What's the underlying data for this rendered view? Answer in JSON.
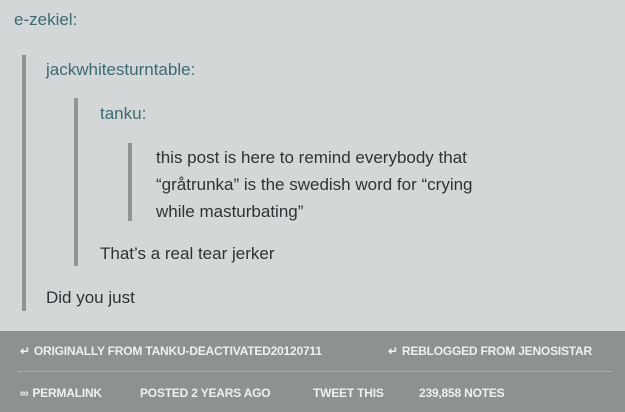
{
  "thread": {
    "level0": {
      "user": "e-zekiel",
      "colon": ":"
    },
    "level1": {
      "user": "jackwhitesturntable",
      "colon": ":",
      "reply": "Did you just"
    },
    "level2": {
      "user": "tanku",
      "colon": ":",
      "reply": "That’s a real tear jerker"
    },
    "level3": {
      "lines": [
        "this post is here to remind everybody that",
        "“gråtrunka” is the swedish word for “crying",
        "while masturbating”"
      ]
    }
  },
  "footer": {
    "originally_icon": "↵",
    "originally_label": "ORIGINALLY FROM TANKU-DEACTIVATED20120711",
    "reblogged_icon": "↵",
    "reblogged_label": "REBLOGGED FROM JENOSISTAR",
    "permalink_icon": "∞",
    "permalink_label": "PERMALINK",
    "posted_label": "POSTED 2 YEARS AGO",
    "tweet_label": "TWEET THIS",
    "notes_label": "239,858 NOTES"
  },
  "colors": {
    "background": "#d3d7d7",
    "username": "#3a6a72",
    "body_text": "#2e3336",
    "quote_bar": "#8f9596",
    "footer_bg": "#8c9192",
    "footer_text": "#eef0f0"
  }
}
